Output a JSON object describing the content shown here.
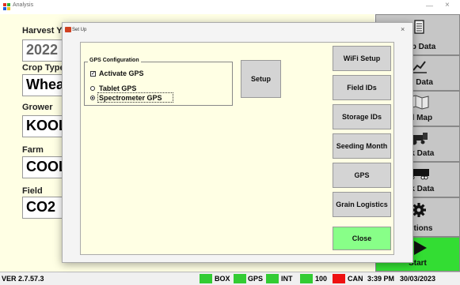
{
  "window": {
    "title": "Analysis"
  },
  "main": {
    "fields": [
      {
        "label": "Harvest Y",
        "value": "2022"
      },
      {
        "label": "Crop Type",
        "value": "Whea"
      },
      {
        "label": "Grower",
        "value": "KOOL"
      },
      {
        "label": "Farm",
        "value": "COOL"
      },
      {
        "label": "Field",
        "value": "CO2"
      }
    ]
  },
  "rightcol": {
    "buttons": [
      {
        "label": "etup Data",
        "icon": "clipboard-icon"
      },
      {
        "label": "eld Data",
        "icon": "chart-icon"
      },
      {
        "label": "eld Map",
        "icon": "map-icon"
      },
      {
        "label": "ank Data",
        "icon": "harvester-icon"
      },
      {
        "label": "uck Data",
        "icon": "truck-icon"
      },
      {
        "label": "Options",
        "icon": "gear-icon"
      },
      {
        "label": "Start",
        "icon": "play-icon"
      }
    ],
    "start_color": "#33dd33"
  },
  "status": {
    "version": "VER 2.7.57.3",
    "box": "BOX",
    "gps": "GPS",
    "int": "INT",
    "count": "100",
    "can": "CAN",
    "time": "3:39 PM",
    "date": "30/03/2023",
    "colors": {
      "ok": "#33cc33",
      "error": "#ee1111"
    }
  },
  "dialog": {
    "title": "Set Up",
    "gps_group": {
      "title": "GPS Configuration",
      "activate_gps": {
        "label": "Activate GPS",
        "checked": true
      },
      "tablet_gps": {
        "label": "Tablet GPS",
        "selected": false
      },
      "spectrometer_gps": {
        "label": "Spectrometer GPS",
        "selected": true
      }
    },
    "setup_button": "Setup",
    "buttons": {
      "wifi": "WiFi Setup",
      "field_ids": "Field IDs",
      "storage_ids": "Storage IDs",
      "seeding_month": "Seeding Month",
      "gps": "GPS",
      "grain_logistics": "Grain Logistics",
      "close": "Close"
    },
    "close_color": "#88ff88"
  }
}
